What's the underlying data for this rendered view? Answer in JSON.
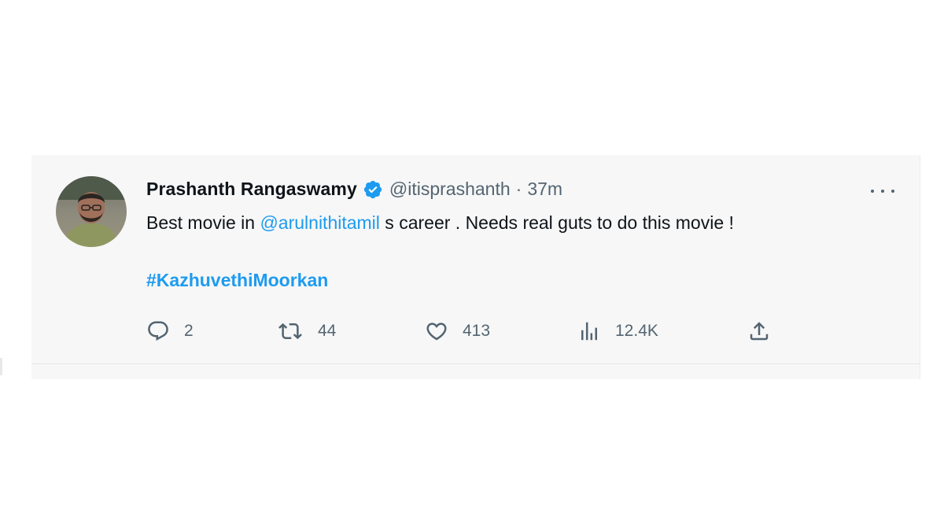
{
  "tweet": {
    "author": {
      "display_name": "Prashanth Rangaswamy",
      "verified_icon": "verified-badge-icon",
      "handle": "@itisprashanth",
      "separator": "·",
      "time": "37m"
    },
    "text": {
      "prefix": "Best movie in ",
      "mention": "@arulnithitamil",
      "suffix": " s career . Needs real guts to do this movie !"
    },
    "hashtag": "#KazhuvethiMoorkan",
    "actions": {
      "replies": "2",
      "retweets": "44",
      "likes": "413",
      "views": "12.4K"
    },
    "more_icon": "more-options-icon"
  },
  "colors": {
    "accent": "#1d9bf0",
    "text_primary": "#0f1419",
    "text_secondary": "#536471",
    "card_bg": "#f7f7f7"
  }
}
